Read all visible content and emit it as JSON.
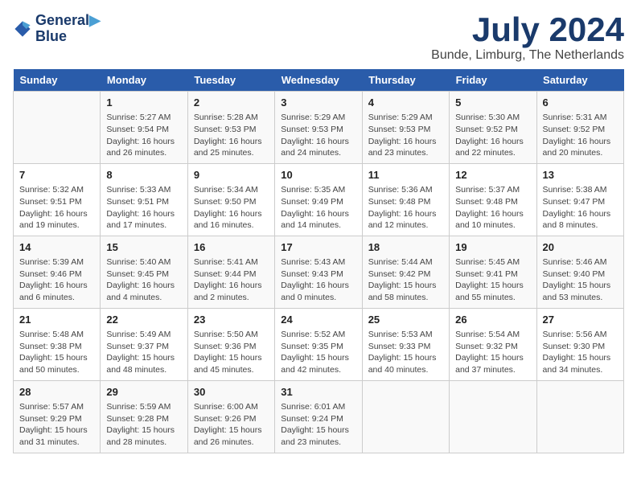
{
  "logo": {
    "line1": "General",
    "line2": "Blue"
  },
  "title": "July 2024",
  "subtitle": "Bunde, Limburg, The Netherlands",
  "days_of_week": [
    "Sunday",
    "Monday",
    "Tuesday",
    "Wednesday",
    "Thursday",
    "Friday",
    "Saturday"
  ],
  "weeks": [
    [
      {
        "day": "",
        "info": ""
      },
      {
        "day": "1",
        "info": "Sunrise: 5:27 AM\nSunset: 9:54 PM\nDaylight: 16 hours\nand 26 minutes."
      },
      {
        "day": "2",
        "info": "Sunrise: 5:28 AM\nSunset: 9:53 PM\nDaylight: 16 hours\nand 25 minutes."
      },
      {
        "day": "3",
        "info": "Sunrise: 5:29 AM\nSunset: 9:53 PM\nDaylight: 16 hours\nand 24 minutes."
      },
      {
        "day": "4",
        "info": "Sunrise: 5:29 AM\nSunset: 9:53 PM\nDaylight: 16 hours\nand 23 minutes."
      },
      {
        "day": "5",
        "info": "Sunrise: 5:30 AM\nSunset: 9:52 PM\nDaylight: 16 hours\nand 22 minutes."
      },
      {
        "day": "6",
        "info": "Sunrise: 5:31 AM\nSunset: 9:52 PM\nDaylight: 16 hours\nand 20 minutes."
      }
    ],
    [
      {
        "day": "7",
        "info": "Sunrise: 5:32 AM\nSunset: 9:51 PM\nDaylight: 16 hours\nand 19 minutes."
      },
      {
        "day": "8",
        "info": "Sunrise: 5:33 AM\nSunset: 9:51 PM\nDaylight: 16 hours\nand 17 minutes."
      },
      {
        "day": "9",
        "info": "Sunrise: 5:34 AM\nSunset: 9:50 PM\nDaylight: 16 hours\nand 16 minutes."
      },
      {
        "day": "10",
        "info": "Sunrise: 5:35 AM\nSunset: 9:49 PM\nDaylight: 16 hours\nand 14 minutes."
      },
      {
        "day": "11",
        "info": "Sunrise: 5:36 AM\nSunset: 9:48 PM\nDaylight: 16 hours\nand 12 minutes."
      },
      {
        "day": "12",
        "info": "Sunrise: 5:37 AM\nSunset: 9:48 PM\nDaylight: 16 hours\nand 10 minutes."
      },
      {
        "day": "13",
        "info": "Sunrise: 5:38 AM\nSunset: 9:47 PM\nDaylight: 16 hours\nand 8 minutes."
      }
    ],
    [
      {
        "day": "14",
        "info": "Sunrise: 5:39 AM\nSunset: 9:46 PM\nDaylight: 16 hours\nand 6 minutes."
      },
      {
        "day": "15",
        "info": "Sunrise: 5:40 AM\nSunset: 9:45 PM\nDaylight: 16 hours\nand 4 minutes."
      },
      {
        "day": "16",
        "info": "Sunrise: 5:41 AM\nSunset: 9:44 PM\nDaylight: 16 hours\nand 2 minutes."
      },
      {
        "day": "17",
        "info": "Sunrise: 5:43 AM\nSunset: 9:43 PM\nDaylight: 16 hours\nand 0 minutes."
      },
      {
        "day": "18",
        "info": "Sunrise: 5:44 AM\nSunset: 9:42 PM\nDaylight: 15 hours\nand 58 minutes."
      },
      {
        "day": "19",
        "info": "Sunrise: 5:45 AM\nSunset: 9:41 PM\nDaylight: 15 hours\nand 55 minutes."
      },
      {
        "day": "20",
        "info": "Sunrise: 5:46 AM\nSunset: 9:40 PM\nDaylight: 15 hours\nand 53 minutes."
      }
    ],
    [
      {
        "day": "21",
        "info": "Sunrise: 5:48 AM\nSunset: 9:38 PM\nDaylight: 15 hours\nand 50 minutes."
      },
      {
        "day": "22",
        "info": "Sunrise: 5:49 AM\nSunset: 9:37 PM\nDaylight: 15 hours\nand 48 minutes."
      },
      {
        "day": "23",
        "info": "Sunrise: 5:50 AM\nSunset: 9:36 PM\nDaylight: 15 hours\nand 45 minutes."
      },
      {
        "day": "24",
        "info": "Sunrise: 5:52 AM\nSunset: 9:35 PM\nDaylight: 15 hours\nand 42 minutes."
      },
      {
        "day": "25",
        "info": "Sunrise: 5:53 AM\nSunset: 9:33 PM\nDaylight: 15 hours\nand 40 minutes."
      },
      {
        "day": "26",
        "info": "Sunrise: 5:54 AM\nSunset: 9:32 PM\nDaylight: 15 hours\nand 37 minutes."
      },
      {
        "day": "27",
        "info": "Sunrise: 5:56 AM\nSunset: 9:30 PM\nDaylight: 15 hours\nand 34 minutes."
      }
    ],
    [
      {
        "day": "28",
        "info": "Sunrise: 5:57 AM\nSunset: 9:29 PM\nDaylight: 15 hours\nand 31 minutes."
      },
      {
        "day": "29",
        "info": "Sunrise: 5:59 AM\nSunset: 9:28 PM\nDaylight: 15 hours\nand 28 minutes."
      },
      {
        "day": "30",
        "info": "Sunrise: 6:00 AM\nSunset: 9:26 PM\nDaylight: 15 hours\nand 26 minutes."
      },
      {
        "day": "31",
        "info": "Sunrise: 6:01 AM\nSunset: 9:24 PM\nDaylight: 15 hours\nand 23 minutes."
      },
      {
        "day": "",
        "info": ""
      },
      {
        "day": "",
        "info": ""
      },
      {
        "day": "",
        "info": ""
      }
    ]
  ]
}
